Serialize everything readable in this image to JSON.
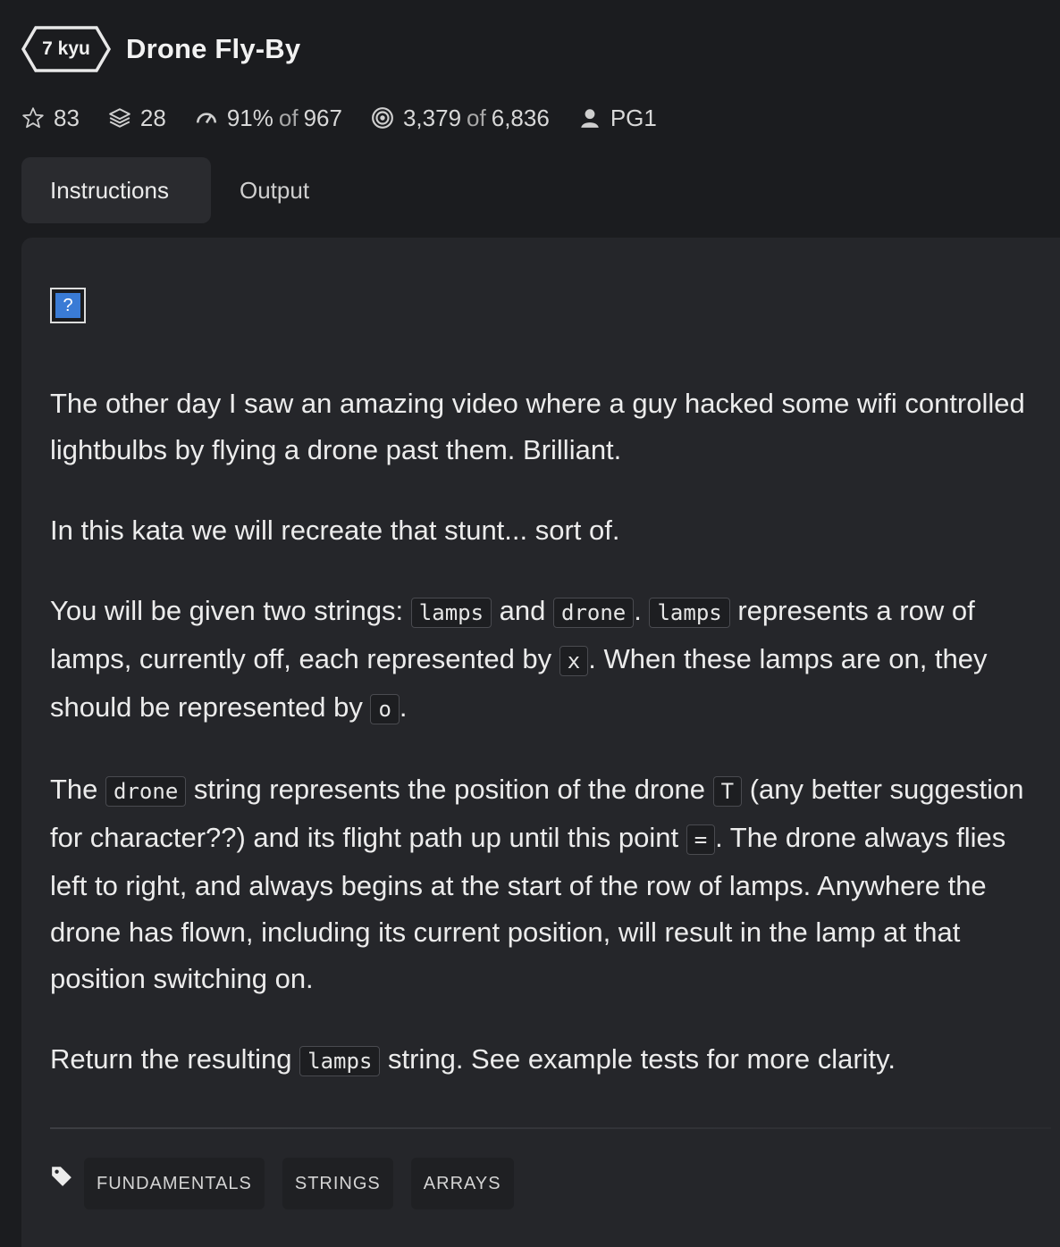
{
  "kata": {
    "rank": "7 kyu",
    "title": "Drone Fly-By"
  },
  "stats": {
    "stars": "83",
    "collections": "28",
    "satisfaction_pct": "91%",
    "satisfaction_of_label": "of",
    "satisfaction_total": "967",
    "completed": "3,379",
    "completed_of_label": "of",
    "completed_total": "6,836",
    "author": "PG1"
  },
  "tabs": [
    {
      "label": "Instructions",
      "active": true
    },
    {
      "label": "Output",
      "active": false
    }
  ],
  "instructions": {
    "image_placeholder": "?",
    "p1": "The other day I saw an amazing video where a guy hacked some wifi controlled lightbulbs by flying a drone past them. Brilliant.",
    "p2": "In this kata we will recreate that stunt... sort of.",
    "p3": {
      "t1": "You will be given two strings: ",
      "c1": "lamps",
      "t2": " and ",
      "c2": "drone",
      "t3": ". ",
      "c3": "lamps",
      "t4": " represents a row of lamps, currently off, each represented by ",
      "c4": "x",
      "t5": ". When these lamps are on, they should be represented by ",
      "c5": "o",
      "t6": "."
    },
    "p4": {
      "t1": "The ",
      "c1": "drone",
      "t2": " string represents the position of the drone ",
      "c2": "T",
      "t3": " (any better suggestion for character??) and its flight path up until this point ",
      "c3": "=",
      "t4": ". The drone always flies left to right, and always begins at the start of the row of lamps. Anywhere the drone has flown, including its current position, will result in the lamp at that position switching on."
    },
    "p5": {
      "t1": "Return the resulting ",
      "c1": "lamps",
      "t2": " string. See example tests for more clarity."
    }
  },
  "tags": [
    "FUNDAMENTALS",
    "STRINGS",
    "ARRAYS"
  ]
}
